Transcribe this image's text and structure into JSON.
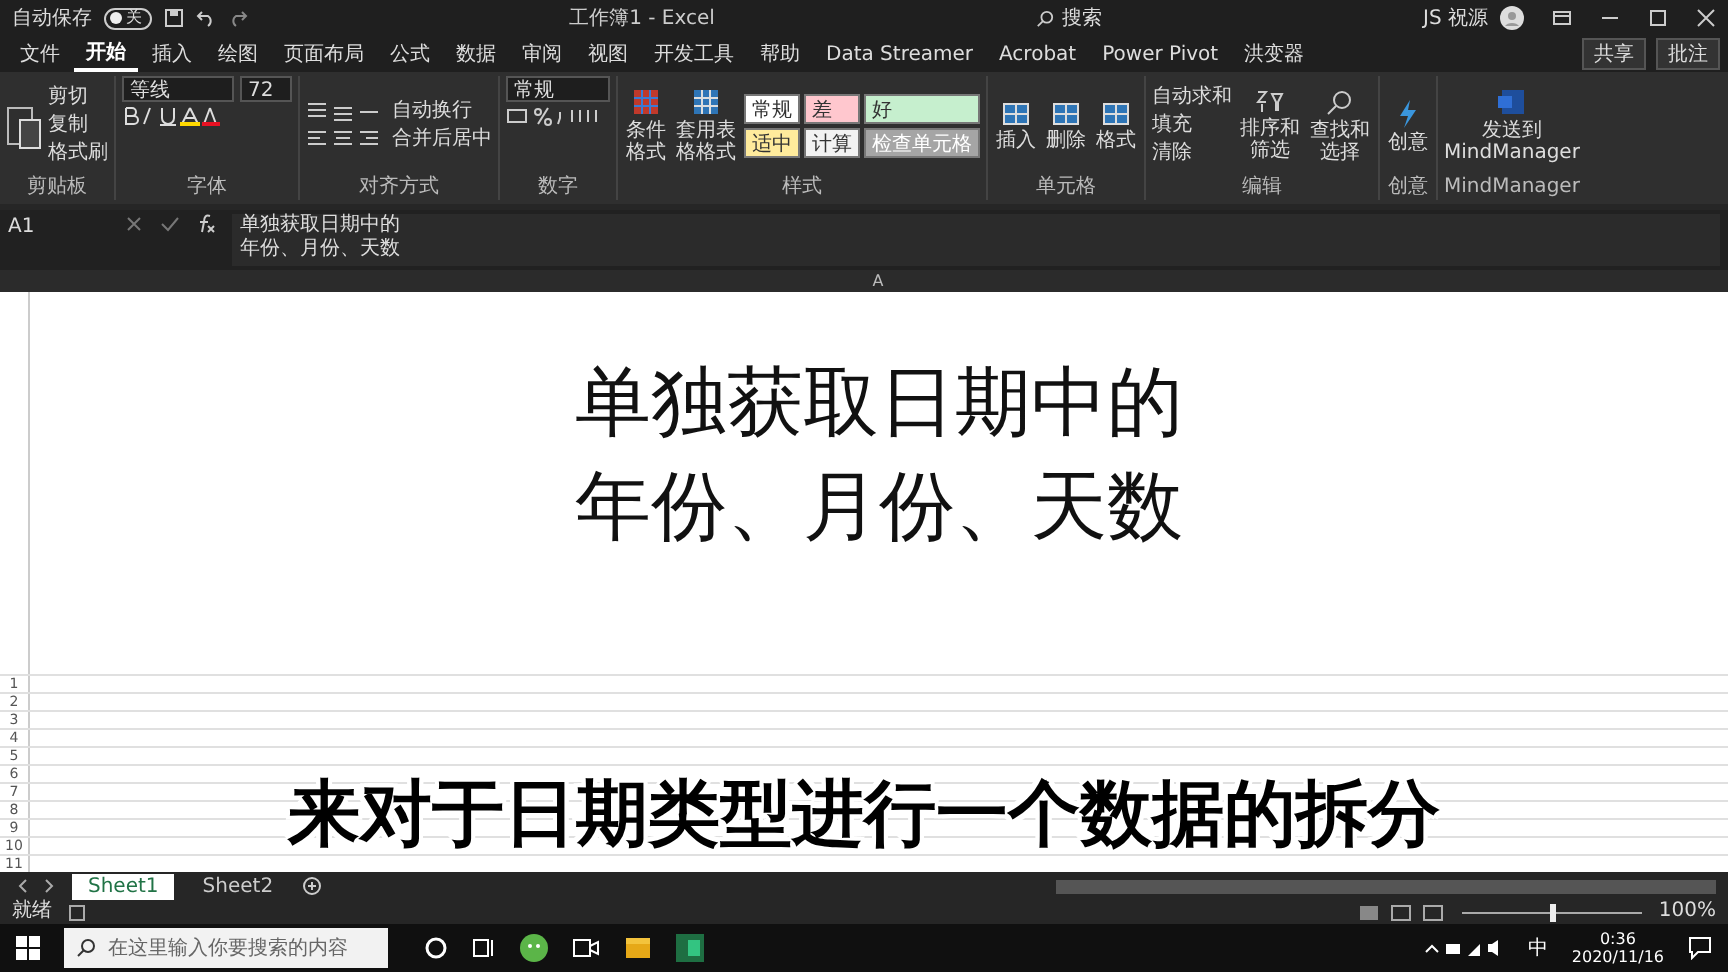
{
  "title_bar": {
    "autosave_label": "自动保存",
    "autosave": {
      "on": false,
      "label": "关"
    },
    "title": "工作簿1 - Excel",
    "search": "搜索",
    "user": "JS 祝源"
  },
  "ribbon_tabs": [
    {
      "label": "文件",
      "selected": false
    },
    {
      "label": "开始",
      "selected": true
    },
    {
      "label": "插入",
      "selected": false
    },
    {
      "label": "绘图",
      "selected": false
    },
    {
      "label": "页面布局",
      "selected": false
    },
    {
      "label": "公式",
      "selected": false
    },
    {
      "label": "数据",
      "selected": false
    },
    {
      "label": "审阅",
      "selected": false
    },
    {
      "label": "视图",
      "selected": false
    },
    {
      "label": "开发工具",
      "selected": false
    },
    {
      "label": "帮助",
      "selected": false
    },
    {
      "label": "Data Streamer",
      "selected": false
    },
    {
      "label": "Acrobat",
      "selected": false
    },
    {
      "label": "Power Pivot",
      "selected": false
    },
    {
      "label": "洪变器",
      "selected": false
    }
  ],
  "share_button": "共享",
  "comments_button": "批注",
  "ribbon": {
    "clipboard": {
      "label": "剪贴板",
      "items": [
        "剪切",
        "复制",
        "格式刷"
      ]
    },
    "font": {
      "label": "字体",
      "name": "等线",
      "size": "72"
    },
    "alignment": {
      "label": "对齐方式",
      "wrap": "自动换行",
      "merge": "合并后居中"
    },
    "number": {
      "label": "数字",
      "format": "常规"
    },
    "styles": {
      "label": "样式",
      "conditional": "条件格式",
      "table": "套用表格格式",
      "cells": [
        {
          "label": "常规",
          "color": "#ffffff"
        },
        {
          "label": "差",
          "color": "#ffc7ce"
        },
        {
          "label": "好",
          "color": "#c6efce"
        },
        {
          "label": "适中",
          "color": "#ffeb9c"
        },
        {
          "label": "计算",
          "color": "#f2f2f2"
        },
        {
          "label": "检查单元格",
          "color": "#a5a5a5"
        }
      ]
    },
    "cells": {
      "label": "单元格",
      "items": [
        "插入",
        "删除",
        "格式"
      ]
    },
    "editing": {
      "label": "编辑",
      "autosum": "自动求和",
      "fill": "填充",
      "clear": "清除",
      "sort": "排序和筛选",
      "find": "查找和选择"
    },
    "ideas": {
      "label": "创意",
      "button": "创意"
    },
    "mindmanager": {
      "label": "MindManager",
      "button": "发送到 MindManager"
    }
  },
  "formula_bar": {
    "name_box": "A1",
    "content": [
      "单独获取日期中的",
      "年份、月份、天数"
    ]
  },
  "sheet": {
    "column": "A",
    "cell_lines": [
      "单独获取日期中的",
      "年份、月份、天数"
    ],
    "rows": [
      "1",
      "2",
      "3",
      "4",
      "5",
      "6",
      "7",
      "8",
      "9",
      "10",
      "11"
    ]
  },
  "subtitle": "来对于日期类型进行一个数据的拆分",
  "sheet_tabs": [
    {
      "label": "Sheet1",
      "selected": true
    },
    {
      "label": "Sheet2",
      "selected": false
    }
  ],
  "status_bar": {
    "status": "就绪",
    "zoom": "100%",
    "zoom_slider": {
      "level": 0.5
    }
  },
  "taskbar": {
    "search_placeholder": "在这里输入你要搜索的内容",
    "ime": "中",
    "time": "0:36",
    "date": "2020/11/16"
  }
}
